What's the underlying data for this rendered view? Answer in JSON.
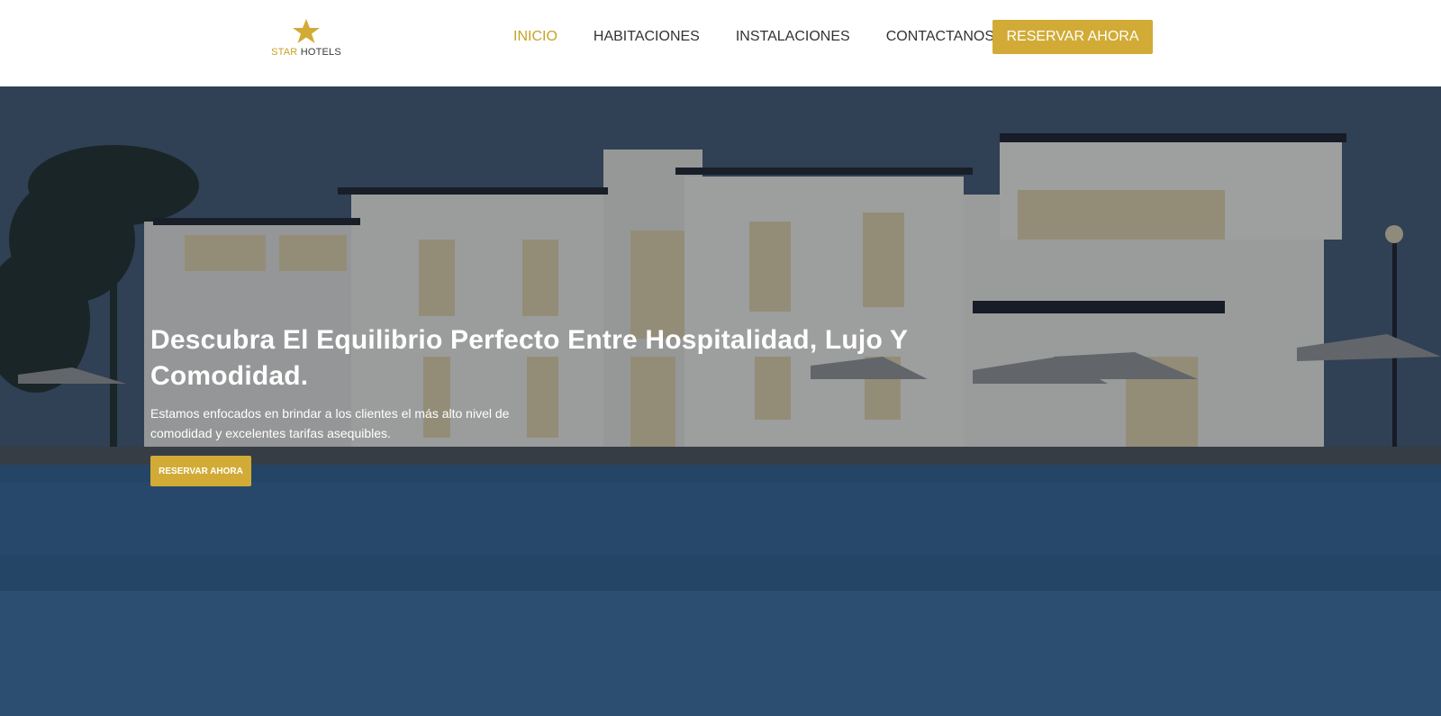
{
  "brand": {
    "logo_icon": "star-icon",
    "name_part1": "STAR",
    "name_part2": "HOTELS"
  },
  "nav": {
    "items": [
      {
        "label": "INICIO",
        "active": true
      },
      {
        "label": "HABITACIONES",
        "active": false
      },
      {
        "label": "INSTALACIONES",
        "active": false
      },
      {
        "label": "CONTACTANOS",
        "active": false
      }
    ],
    "cta_label": "RESERVAR AHORA"
  },
  "hero": {
    "title": "Descubra El Equilibrio Perfecto Entre Hospitalidad, Lujo Y Comodidad.",
    "subtitle": "Estamos enfocados en brindar a los clientes el más alto nivel de comodidad y excelentes tarifas asequibles.",
    "cta_label": "RESERVAR AHORA"
  },
  "colors": {
    "accent": "#d1ab36",
    "nav_active": "#c9a227",
    "nav_text": "#333333",
    "hero_overlay": "#1e2c3c"
  }
}
